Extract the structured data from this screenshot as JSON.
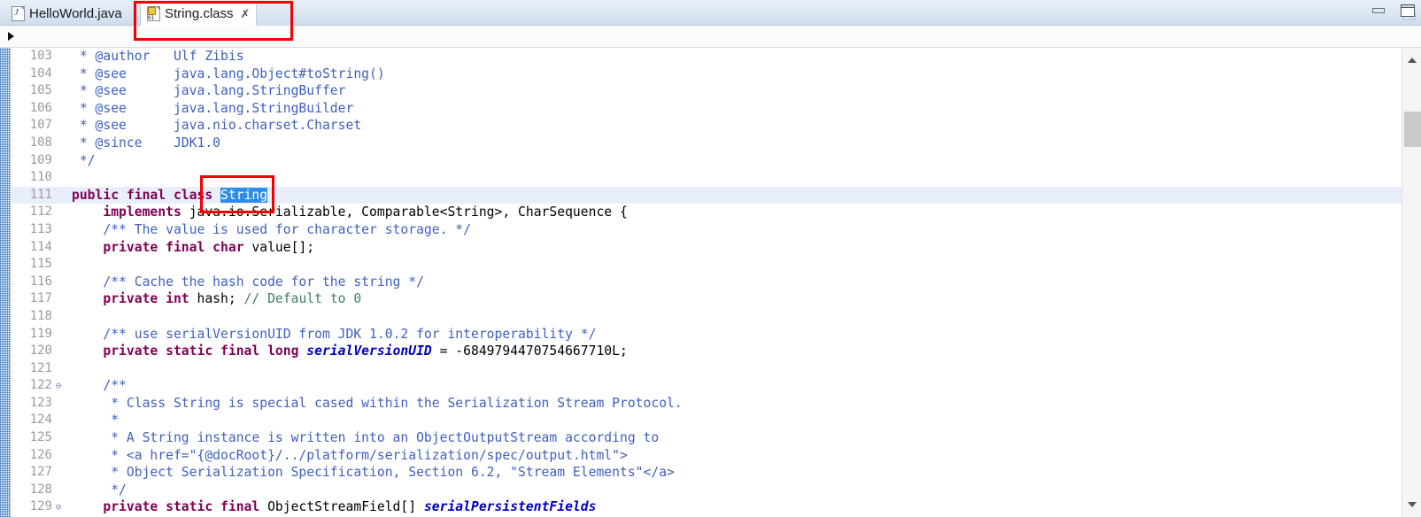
{
  "window": {
    "minimize_label": "Minimize",
    "maximize_label": "Maximize"
  },
  "tabs": [
    {
      "label": "HelloWorld.java",
      "icon": "java-file-icon",
      "active": false,
      "closable": false
    },
    {
      "label": "String.class",
      "icon": "class-file-icon",
      "active": true,
      "closable": true,
      "close_glyph": "✗"
    }
  ],
  "breadcrumb": {
    "expand_glyph": "▶"
  },
  "scrollbar": {
    "up_glyph": "∧",
    "down_glyph": "∨"
  },
  "annotations": [
    {
      "name": "tab-highlight",
      "color": "#f50000"
    },
    {
      "name": "class-name-highlight",
      "color": "#f50000"
    }
  ],
  "editor": {
    "file": "String.class",
    "selected_text": "String",
    "current_line": 111,
    "colors": {
      "keyword": "#7f0055",
      "javadoc": "#3f5fbf",
      "line_comment": "#3f7f5f",
      "static_field": "#0000c0",
      "selection_bg": "#2f8ce8",
      "current_line_bg": "#e8eefb",
      "gutter_text": "#9a9a9a"
    },
    "lines": [
      {
        "num": "103",
        "fold": "",
        "hl": false,
        "parts": [
          {
            "c": "jd",
            "t": " * @author   Ulf Zibis"
          }
        ]
      },
      {
        "num": "104",
        "fold": "",
        "hl": false,
        "parts": [
          {
            "c": "jd",
            "t": " * @see      java.lang.Object#toString()"
          }
        ]
      },
      {
        "num": "105",
        "fold": "",
        "hl": false,
        "parts": [
          {
            "c": "jd",
            "t": " * @see      java.lang.StringBuffer"
          }
        ]
      },
      {
        "num": "106",
        "fold": "",
        "hl": false,
        "parts": [
          {
            "c": "jd",
            "t": " * @see      java.lang.StringBuilder"
          }
        ]
      },
      {
        "num": "107",
        "fold": "",
        "hl": false,
        "parts": [
          {
            "c": "jd",
            "t": " * @see      java.nio.charset.Charset"
          }
        ]
      },
      {
        "num": "108",
        "fold": "",
        "hl": false,
        "parts": [
          {
            "c": "jd",
            "t": " * @since    JDK1.0"
          }
        ]
      },
      {
        "num": "109",
        "fold": "",
        "hl": false,
        "parts": [
          {
            "c": "jd",
            "t": " */"
          }
        ]
      },
      {
        "num": "110",
        "fold": "",
        "hl": false,
        "parts": [
          {
            "c": "plain",
            "t": ""
          }
        ]
      },
      {
        "num": "111",
        "fold": "",
        "hl": true,
        "parts": [
          {
            "c": "kw",
            "t": "public final class"
          },
          {
            "c": "plain",
            "t": " "
          },
          {
            "c": "sel",
            "t": "String"
          }
        ]
      },
      {
        "num": "112",
        "fold": "",
        "hl": false,
        "parts": [
          {
            "c": "kw",
            "t": "    implements"
          },
          {
            "c": "plain",
            "t": " java.io.Serializable, Comparable<String>, CharSequence {"
          }
        ]
      },
      {
        "num": "113",
        "fold": "",
        "hl": false,
        "parts": [
          {
            "c": "jd",
            "t": "    /** The value is used for character storage. */"
          }
        ]
      },
      {
        "num": "114",
        "fold": "",
        "hl": false,
        "parts": [
          {
            "c": "kw",
            "t": "    private final char"
          },
          {
            "c": "plain",
            "t": " value[];"
          }
        ]
      },
      {
        "num": "115",
        "fold": "",
        "hl": false,
        "parts": [
          {
            "c": "plain",
            "t": ""
          }
        ]
      },
      {
        "num": "116",
        "fold": "",
        "hl": false,
        "parts": [
          {
            "c": "jd",
            "t": "    /** Cache the hash code for the string */"
          }
        ]
      },
      {
        "num": "117",
        "fold": "",
        "hl": false,
        "parts": [
          {
            "c": "kw",
            "t": "    private int"
          },
          {
            "c": "plain",
            "t": " hash; "
          },
          {
            "c": "lc",
            "t": "// Default to 0"
          }
        ]
      },
      {
        "num": "118",
        "fold": "",
        "hl": false,
        "parts": [
          {
            "c": "plain",
            "t": ""
          }
        ]
      },
      {
        "num": "119",
        "fold": "",
        "hl": false,
        "parts": [
          {
            "c": "jd",
            "t": "    /** use serialVersionUID from JDK 1.0.2 for interoperability */"
          }
        ]
      },
      {
        "num": "120",
        "fold": "",
        "hl": false,
        "parts": [
          {
            "c": "kw",
            "t": "    private static final long"
          },
          {
            "c": "plain",
            "t": " "
          },
          {
            "c": "fld",
            "t": "serialVersionUID"
          },
          {
            "c": "plain",
            "t": " = -6849794470754667710L;"
          }
        ]
      },
      {
        "num": "121",
        "fold": "",
        "hl": false,
        "parts": [
          {
            "c": "plain",
            "t": ""
          }
        ]
      },
      {
        "num": "122",
        "fold": "⊖",
        "hl": false,
        "parts": [
          {
            "c": "jd",
            "t": "    /**"
          }
        ]
      },
      {
        "num": "123",
        "fold": "",
        "hl": false,
        "parts": [
          {
            "c": "jd",
            "t": "     * Class String is special cased within the Serialization Stream Protocol."
          }
        ]
      },
      {
        "num": "124",
        "fold": "",
        "hl": false,
        "parts": [
          {
            "c": "jd",
            "t": "     *"
          }
        ]
      },
      {
        "num": "125",
        "fold": "",
        "hl": false,
        "parts": [
          {
            "c": "jd",
            "t": "     * A String instance is written into an ObjectOutputStream according to"
          }
        ]
      },
      {
        "num": "126",
        "fold": "",
        "hl": false,
        "parts": [
          {
            "c": "jd",
            "t": "     * <a href=\"{@docRoot}/../platform/serialization/spec/output.html\">"
          }
        ]
      },
      {
        "num": "127",
        "fold": "",
        "hl": false,
        "parts": [
          {
            "c": "jd",
            "t": "     * Object Serialization Specification, Section 6.2, \"Stream Elements\"</a>"
          }
        ]
      },
      {
        "num": "128",
        "fold": "",
        "hl": false,
        "parts": [
          {
            "c": "jd",
            "t": "     */"
          }
        ]
      },
      {
        "num": "129",
        "fold": "⊖",
        "hl": false,
        "parts": [
          {
            "c": "kw",
            "t": "    private static final"
          },
          {
            "c": "plain",
            "t": " ObjectStreamField[] "
          },
          {
            "c": "fld",
            "t": "serialPersistentFields"
          }
        ]
      }
    ]
  }
}
